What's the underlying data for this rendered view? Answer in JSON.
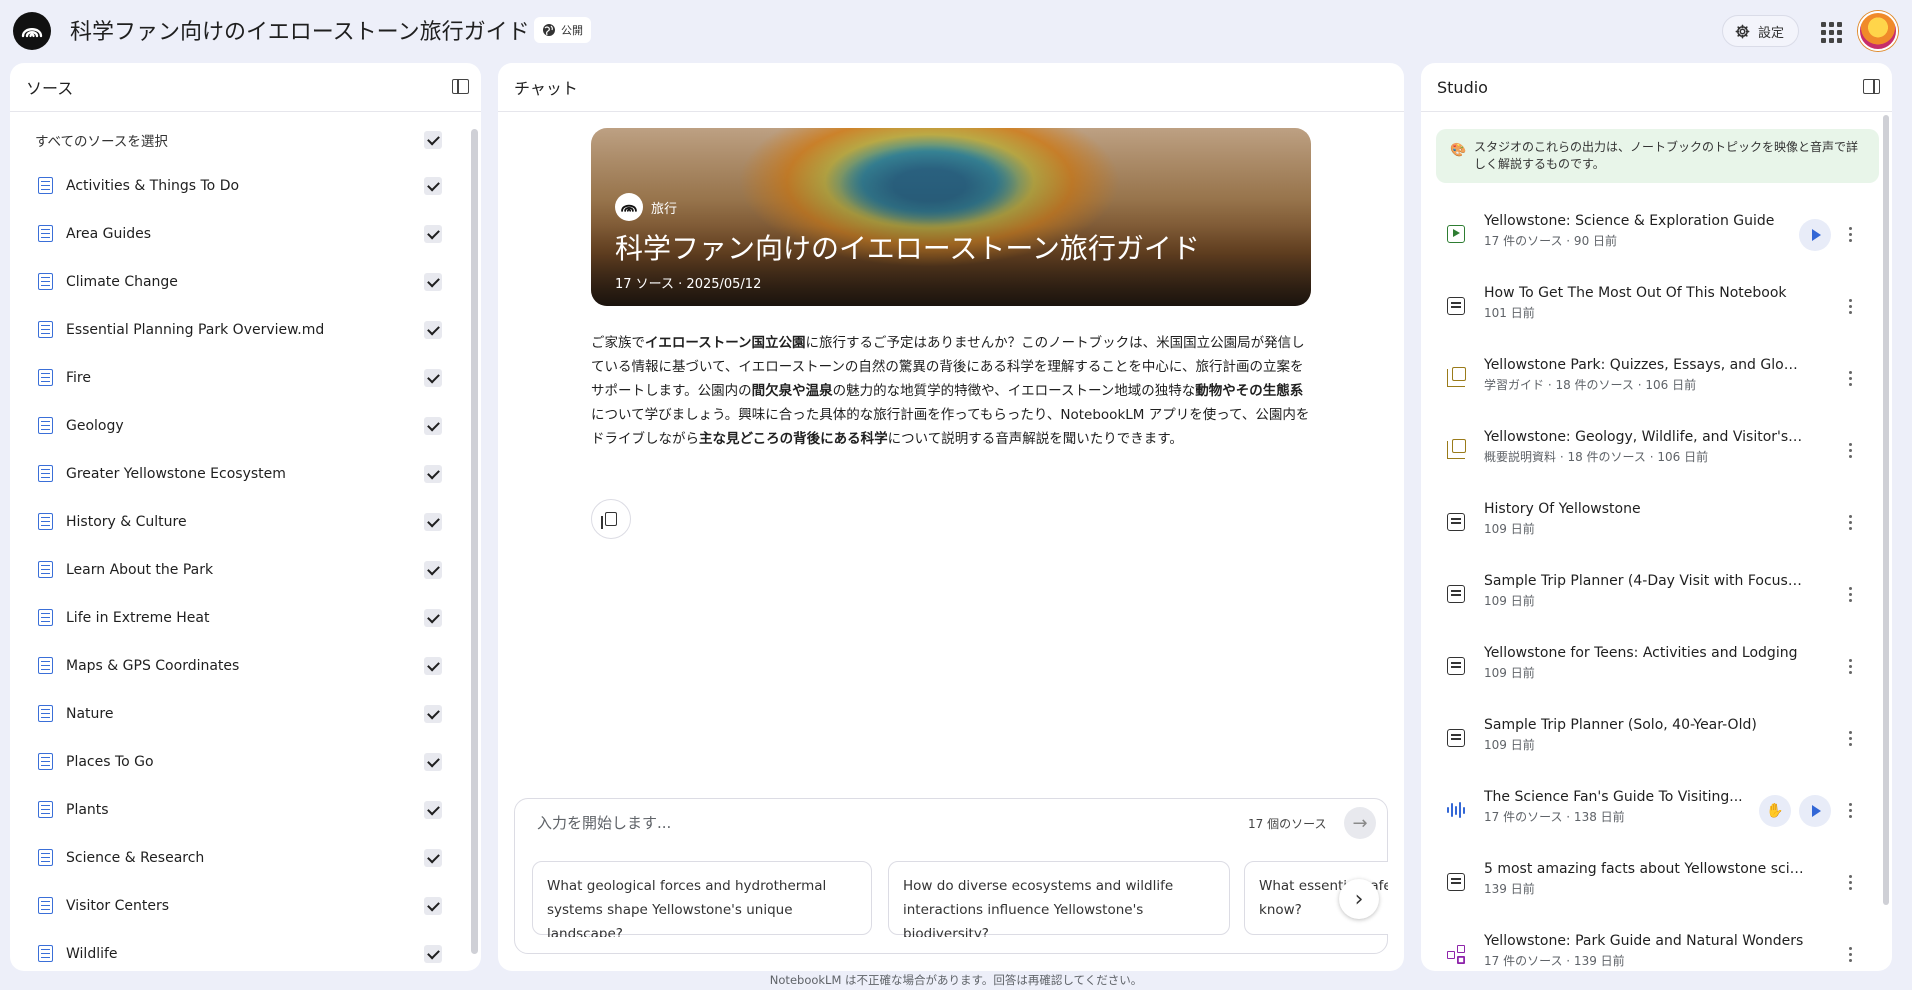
{
  "header": {
    "title": "科学ファン向けのイエローストーン旅行ガイド",
    "public_label": "公開",
    "settings_label": "設定"
  },
  "sources": {
    "panel_title": "ソース",
    "select_all_label": "すべてのソースを選択",
    "items": [
      {
        "label": "Activities & Things To Do",
        "checked": true
      },
      {
        "label": "Area Guides",
        "checked": true
      },
      {
        "label": "Climate Change",
        "checked": true
      },
      {
        "label": "Essential Planning Park Overview.md",
        "checked": true
      },
      {
        "label": "Fire",
        "checked": true
      },
      {
        "label": "Geology",
        "checked": true
      },
      {
        "label": "Greater Yellowstone Ecosystem",
        "checked": true
      },
      {
        "label": "History & Culture",
        "checked": true
      },
      {
        "label": "Learn About the Park",
        "checked": true
      },
      {
        "label": "Life in Extreme Heat",
        "checked": true
      },
      {
        "label": "Maps & GPS Coordinates",
        "checked": true
      },
      {
        "label": "Nature",
        "checked": true
      },
      {
        "label": "Places To Go",
        "checked": true
      },
      {
        "label": "Plants",
        "checked": true
      },
      {
        "label": "Science & Research",
        "checked": true
      },
      {
        "label": "Visitor Centers",
        "checked": true
      },
      {
        "label": "Wildlife",
        "checked": true
      }
    ]
  },
  "chat": {
    "panel_title": "チャット",
    "hero": {
      "tag": "旅行",
      "title": "科学ファン向けのイエローストーン旅行ガイド",
      "meta": "17 ソース · 2025/05/12"
    },
    "summary": [
      {
        "text": "ご家族で",
        "bold": false
      },
      {
        "text": "イエローストーン国立公園",
        "bold": true
      },
      {
        "text": "に旅行するご予定はありませんか？このノートブックは、米国国立公園局が発信している情報に基づいて、イエローストーンの自然の驚異の背後にある科学を理解することを中心に、旅行計画の立案をサポートします。公園内の",
        "bold": false
      },
      {
        "text": "間欠泉や温泉",
        "bold": true
      },
      {
        "text": "の魅力的な地質学的特徴や、イエローストーン地域の独特な",
        "bold": false
      },
      {
        "text": "動物やその生態系",
        "bold": true
      },
      {
        "text": "について学びましょう。興味に合った具体的な旅行計画を作ってもらったり、NotebookLM アプリを使って、公園内をドライブしながら",
        "bold": false
      },
      {
        "text": "主な見どころの背後にある科学",
        "bold": true
      },
      {
        "text": "について説明する音声解説を聞いたりできます。",
        "bold": false
      }
    ],
    "input_placeholder": "入力を開始します...",
    "source_count": "17 個のソース",
    "suggestions": [
      "What geological forces and hydrothermal systems shape Yellowstone's unique landscape?",
      "How do diverse ecosystems and wildlife interactions influence Yellowstone's biodiversity?",
      "What essential safety tips must visitors know?"
    ]
  },
  "studio": {
    "panel_title": "Studio",
    "banner_icon": "palette-icon",
    "banner_text": "スタジオのこれらの出力は、ノートブックのトピックを映像と音声で詳しく解説するものです。",
    "items": [
      {
        "icon": "video-icon",
        "title": "Yellowstone: Science & Exploration Guide",
        "meta": "17 件のソース · 90 日前",
        "play": true,
        "interactive": false
      },
      {
        "icon": "note-icon",
        "title": "How To Get The Most Out Of This Notebook",
        "meta": "101 日前",
        "play": false,
        "interactive": false
      },
      {
        "icon": "guide-icon",
        "title": "Yellowstone Park: Quizzes, Essays, and Glossary",
        "meta": "学習ガイド · 18 件のソース · 106 日前",
        "play": false,
        "interactive": false
      },
      {
        "icon": "guide-icon",
        "title": "Yellowstone: Geology, Wildlife, and Visitor's Guide",
        "meta": "概要説明資料 · 18 件のソース · 106 日前",
        "play": false,
        "interactive": false
      },
      {
        "icon": "note-icon",
        "title": "History Of Yellowstone",
        "meta": "109 日前",
        "play": false,
        "interactive": false
      },
      {
        "icon": "note-icon",
        "title": "Sample Trip Planner (4-Day Visit with Focus on...",
        "meta": "109 日前",
        "play": false,
        "interactive": false
      },
      {
        "icon": "note-icon",
        "title": "Yellowstone for Teens: Activities and Lodging",
        "meta": "109 日前",
        "play": false,
        "interactive": false
      },
      {
        "icon": "note-icon",
        "title": "Sample Trip Planner (Solo, 40-Year-Old)",
        "meta": "109 日前",
        "play": false,
        "interactive": false
      },
      {
        "icon": "audio-icon",
        "title": "The Science Fan's Guide To Visiting...",
        "meta": "17 件のソース · 138 日前",
        "play": true,
        "interactive": true
      },
      {
        "icon": "note-icon",
        "title": "5 most amazing facts about Yellowstone science",
        "meta": "139 日前",
        "play": false,
        "interactive": false
      },
      {
        "icon": "mind-map-icon",
        "title": "Yellowstone: Park Guide and Natural Wonders",
        "meta": "17 件のソース · 139 日前",
        "play": false,
        "interactive": false
      }
    ]
  },
  "footer": {
    "disclaimer": "NotebookLM は不正確な場合があります。回答は再確認してください。"
  }
}
